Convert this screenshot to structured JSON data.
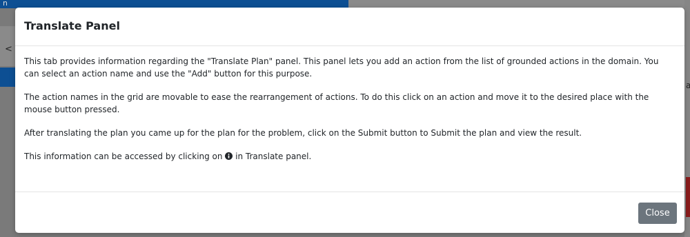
{
  "background": {
    "left_glyph_top": "n",
    "left_glyph": "<",
    "right_glyph": "a"
  },
  "modal": {
    "title": "Translate Panel",
    "paragraphs": [
      "This tab provides information regarding the \"Translate Plan\" panel. This panel lets you add an action from the list of grounded actions in the domain. You can select an action name and use the \"Add\" button for this purpose.",
      "The action names in the grid are movable to ease the rearrangement of actions. To do this click on an action and move it to the desired place with the mouse button pressed.",
      "After translating the plan you came up for the plan for the problem, click on the Submit button to Submit the plan and view the result."
    ],
    "info_line": {
      "before": "This information can be accessed by clicking on ",
      "icon": "info-circle-icon",
      "after": " in Translate panel."
    },
    "close_label": "Close"
  },
  "colors": {
    "background_overlay": "#7a7a7a",
    "brand_blue": "#0d4f93",
    "close_button": "#6c757d"
  }
}
